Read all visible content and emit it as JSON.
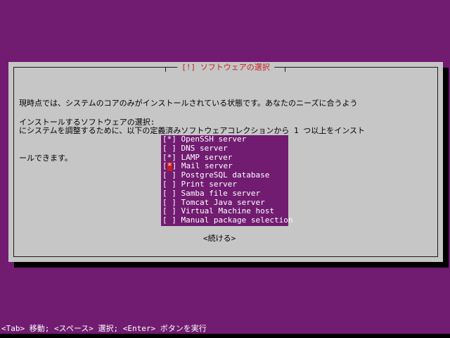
{
  "dialog": {
    "title": "[!] ソフトウェアの選択",
    "prompt_lines": [
      "現時点では、システムのコアのみがインストールされている状態です。あなたのニーズに合うよう",
      "にシステムを調整するために、以下の定義済みソフトウェアコレクションから 1 つ以上をインスト",
      "ールできます。"
    ],
    "select_label": "インストールするソフトウェアの選択:",
    "items": [
      {
        "check": "[*]",
        "label": "OpenSSH server"
      },
      {
        "check": "[ ]",
        "label": "DNS server"
      },
      {
        "check": "[*]",
        "label": "LAMP server"
      },
      {
        "check": "[*]",
        "label": "Mail server"
      },
      {
        "check": "[ ]",
        "label": "PostgreSQL database"
      },
      {
        "check": "[ ]",
        "label": "Print server"
      },
      {
        "check": "[ ]",
        "label": "Samba file server"
      },
      {
        "check": "[ ]",
        "label": "Tomcat Java server"
      },
      {
        "check": "[ ]",
        "label": "Virtual Machine host"
      },
      {
        "check": "[ ]",
        "label": "Manual package selection"
      }
    ],
    "focused_item_index": 3,
    "continue_label": "<続ける>"
  },
  "status_bar": {
    "text": "<Tab> 移動; <スペース> 選択; <Enter> ボタンを実行"
  },
  "colors": {
    "background": "#711c71",
    "dialog": "#c6c6c6",
    "title": "#c41e1e",
    "cursor": "#c41e1e",
    "list_text": "#ffffff"
  }
}
